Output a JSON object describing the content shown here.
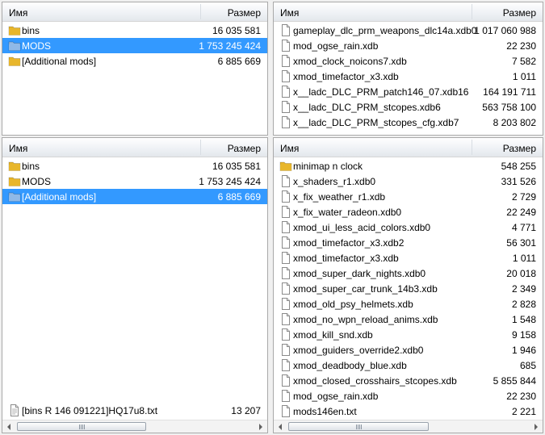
{
  "header": {
    "name": "Имя",
    "size": "Размер"
  },
  "panes": {
    "top_left": {
      "rows": [
        {
          "icon": "folder",
          "name": "bins",
          "size": "16 035 581",
          "selected": false
        },
        {
          "icon": "folder",
          "name": "MODS",
          "size": "1 753 245 424",
          "selected": true
        },
        {
          "icon": "folder",
          "name": "[Additional mods]",
          "size": "6 885 669",
          "selected": false
        }
      ]
    },
    "top_right": {
      "rows": [
        {
          "icon": "file",
          "name": "gameplay_dlc_prm_weapons_dlc14a.xdb0",
          "size": "1 017 060 988"
        },
        {
          "icon": "file",
          "name": "mod_ogse_rain.xdb",
          "size": "22 230"
        },
        {
          "icon": "file",
          "name": "xmod_clock_noicons7.xdb",
          "size": "7 582"
        },
        {
          "icon": "file",
          "name": "xmod_timefactor_x3.xdb",
          "size": "1 011"
        },
        {
          "icon": "file",
          "name": "x__ladc_DLC_PRM_patch146_07.xdb16",
          "size": "164 191 711"
        },
        {
          "icon": "file",
          "name": "x__ladc_DLC_PRM_stcopes.xdb6",
          "size": "563 758 100"
        },
        {
          "icon": "file",
          "name": "x__ladc_DLC_PRM_stcopes_cfg.xdb7",
          "size": "8 203 802"
        }
      ]
    },
    "bottom_left": {
      "rows": [
        {
          "icon": "folder",
          "name": "bins",
          "size": "16 035 581",
          "selected": false
        },
        {
          "icon": "folder",
          "name": "MODS",
          "size": "1 753 245 424",
          "selected": false
        },
        {
          "icon": "folder",
          "name": "[Additional mods]",
          "size": "6 885 669",
          "selected": true
        }
      ],
      "bottom_file": {
        "icon": "file",
        "name": "[bins R 146 091221]HQ17u8.txt",
        "size": "13 207"
      }
    },
    "bottom_right": {
      "rows": [
        {
          "icon": "folder",
          "name": "minimap n clock",
          "size": "548 255"
        },
        {
          "icon": "file",
          "name": "x_shaders_r1.xdb0",
          "size": "331 526"
        },
        {
          "icon": "file",
          "name": "x_fix_weather_r1.xdb",
          "size": "2 729"
        },
        {
          "icon": "file",
          "name": "x_fix_water_radeon.xdb0",
          "size": "22 249"
        },
        {
          "icon": "file",
          "name": "xmod_ui_less_acid_colors.xdb0",
          "size": "4 771"
        },
        {
          "icon": "file",
          "name": "xmod_timefactor_x3.xdb2",
          "size": "56 301"
        },
        {
          "icon": "file",
          "name": "xmod_timefactor_x3.xdb",
          "size": "1 011"
        },
        {
          "icon": "file",
          "name": "xmod_super_dark_nights.xdb0",
          "size": "20 018"
        },
        {
          "icon": "file",
          "name": "xmod_super_car_trunk_14b3.xdb",
          "size": "2 349"
        },
        {
          "icon": "file",
          "name": "xmod_old_psy_helmets.xdb",
          "size": "2 828"
        },
        {
          "icon": "file",
          "name": "xmod_no_wpn_reload_anims.xdb",
          "size": "1 548"
        },
        {
          "icon": "file",
          "name": "xmod_kill_snd.xdb",
          "size": "9 158"
        },
        {
          "icon": "file",
          "name": "xmod_guiders_override2.xdb0",
          "size": "1 946"
        },
        {
          "icon": "file",
          "name": "xmod_deadbody_blue.xdb",
          "size": "685"
        },
        {
          "icon": "file",
          "name": "xmod_closed_crosshairs_stcopes.xdb",
          "size": "5 855 844"
        },
        {
          "icon": "file",
          "name": "mod_ogse_rain.xdb",
          "size": "22 230"
        },
        {
          "icon": "file",
          "name": "mods146en.txt",
          "size": "2 221"
        }
      ]
    }
  },
  "colors": {
    "selection": "#3399ff",
    "folder": "#e8b62b",
    "folder_selected": "#8fb9e6"
  }
}
